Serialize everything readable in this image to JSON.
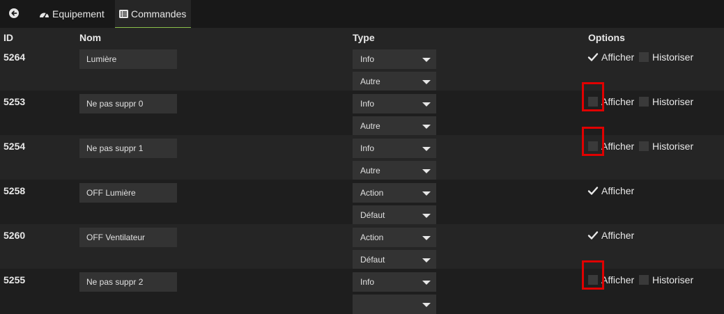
{
  "tabs": {
    "equipement_label": "Equipement",
    "commandes_label": "Commandes"
  },
  "table": {
    "headers": {
      "id": "ID",
      "nom": "Nom",
      "type": "Type",
      "options": "Options"
    },
    "rows": [
      {
        "id": "5264",
        "name": "Lumière",
        "type": "Info",
        "subtype": "Autre",
        "afficher": true,
        "afficher_label": "Afficher",
        "historiser": false,
        "historiser_label": "Historiser",
        "highlighted": false
      },
      {
        "id": "5253",
        "name": "Ne pas suppr 0",
        "type": "Info",
        "subtype": "Autre",
        "afficher": false,
        "afficher_label": "Afficher",
        "historiser": false,
        "historiser_label": "Historiser",
        "highlighted": true
      },
      {
        "id": "5254",
        "name": "Ne pas suppr 1",
        "type": "Info",
        "subtype": "Autre",
        "afficher": false,
        "afficher_label": "Afficher",
        "historiser": false,
        "historiser_label": "Historiser",
        "highlighted": true
      },
      {
        "id": "5258",
        "name": "OFF Lumière",
        "type": "Action",
        "subtype": "Défaut",
        "afficher": true,
        "afficher_label": "Afficher",
        "historiser": null,
        "historiser_label": "",
        "highlighted": false
      },
      {
        "id": "5260",
        "name": "OFF Ventilateur",
        "type": "Action",
        "subtype": "Défaut",
        "afficher": true,
        "afficher_label": "Afficher",
        "historiser": null,
        "historiser_label": "",
        "highlighted": false
      },
      {
        "id": "5255",
        "name": "Ne pas suppr 2",
        "type": "Info",
        "subtype": "",
        "afficher": false,
        "afficher_label": "Afficher",
        "historiser": false,
        "historiser_label": "Historiser",
        "highlighted": true
      }
    ]
  },
  "colors": {
    "accent": "#8cc04a",
    "highlight": "#e00000"
  }
}
